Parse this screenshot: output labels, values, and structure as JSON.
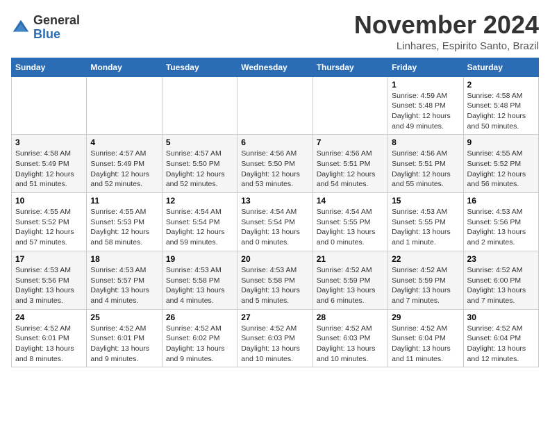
{
  "logo": {
    "general": "General",
    "blue": "Blue"
  },
  "header": {
    "month": "November 2024",
    "location": "Linhares, Espirito Santo, Brazil"
  },
  "weekdays": [
    "Sunday",
    "Monday",
    "Tuesday",
    "Wednesday",
    "Thursday",
    "Friday",
    "Saturday"
  ],
  "weeks": [
    [
      {
        "day": "",
        "info": ""
      },
      {
        "day": "",
        "info": ""
      },
      {
        "day": "",
        "info": ""
      },
      {
        "day": "",
        "info": ""
      },
      {
        "day": "",
        "info": ""
      },
      {
        "day": "1",
        "info": "Sunrise: 4:59 AM\nSunset: 5:48 PM\nDaylight: 12 hours and 49 minutes."
      },
      {
        "day": "2",
        "info": "Sunrise: 4:58 AM\nSunset: 5:48 PM\nDaylight: 12 hours and 50 minutes."
      }
    ],
    [
      {
        "day": "3",
        "info": "Sunrise: 4:58 AM\nSunset: 5:49 PM\nDaylight: 12 hours and 51 minutes."
      },
      {
        "day": "4",
        "info": "Sunrise: 4:57 AM\nSunset: 5:49 PM\nDaylight: 12 hours and 52 minutes."
      },
      {
        "day": "5",
        "info": "Sunrise: 4:57 AM\nSunset: 5:50 PM\nDaylight: 12 hours and 52 minutes."
      },
      {
        "day": "6",
        "info": "Sunrise: 4:56 AM\nSunset: 5:50 PM\nDaylight: 12 hours and 53 minutes."
      },
      {
        "day": "7",
        "info": "Sunrise: 4:56 AM\nSunset: 5:51 PM\nDaylight: 12 hours and 54 minutes."
      },
      {
        "day": "8",
        "info": "Sunrise: 4:56 AM\nSunset: 5:51 PM\nDaylight: 12 hours and 55 minutes."
      },
      {
        "day": "9",
        "info": "Sunrise: 4:55 AM\nSunset: 5:52 PM\nDaylight: 12 hours and 56 minutes."
      }
    ],
    [
      {
        "day": "10",
        "info": "Sunrise: 4:55 AM\nSunset: 5:52 PM\nDaylight: 12 hours and 57 minutes."
      },
      {
        "day": "11",
        "info": "Sunrise: 4:55 AM\nSunset: 5:53 PM\nDaylight: 12 hours and 58 minutes."
      },
      {
        "day": "12",
        "info": "Sunrise: 4:54 AM\nSunset: 5:54 PM\nDaylight: 12 hours and 59 minutes."
      },
      {
        "day": "13",
        "info": "Sunrise: 4:54 AM\nSunset: 5:54 PM\nDaylight: 13 hours and 0 minutes."
      },
      {
        "day": "14",
        "info": "Sunrise: 4:54 AM\nSunset: 5:55 PM\nDaylight: 13 hours and 0 minutes."
      },
      {
        "day": "15",
        "info": "Sunrise: 4:53 AM\nSunset: 5:55 PM\nDaylight: 13 hours and 1 minute."
      },
      {
        "day": "16",
        "info": "Sunrise: 4:53 AM\nSunset: 5:56 PM\nDaylight: 13 hours and 2 minutes."
      }
    ],
    [
      {
        "day": "17",
        "info": "Sunrise: 4:53 AM\nSunset: 5:56 PM\nDaylight: 13 hours and 3 minutes."
      },
      {
        "day": "18",
        "info": "Sunrise: 4:53 AM\nSunset: 5:57 PM\nDaylight: 13 hours and 4 minutes."
      },
      {
        "day": "19",
        "info": "Sunrise: 4:53 AM\nSunset: 5:58 PM\nDaylight: 13 hours and 4 minutes."
      },
      {
        "day": "20",
        "info": "Sunrise: 4:53 AM\nSunset: 5:58 PM\nDaylight: 13 hours and 5 minutes."
      },
      {
        "day": "21",
        "info": "Sunrise: 4:52 AM\nSunset: 5:59 PM\nDaylight: 13 hours and 6 minutes."
      },
      {
        "day": "22",
        "info": "Sunrise: 4:52 AM\nSunset: 5:59 PM\nDaylight: 13 hours and 7 minutes."
      },
      {
        "day": "23",
        "info": "Sunrise: 4:52 AM\nSunset: 6:00 PM\nDaylight: 13 hours and 7 minutes."
      }
    ],
    [
      {
        "day": "24",
        "info": "Sunrise: 4:52 AM\nSunset: 6:01 PM\nDaylight: 13 hours and 8 minutes."
      },
      {
        "day": "25",
        "info": "Sunrise: 4:52 AM\nSunset: 6:01 PM\nDaylight: 13 hours and 9 minutes."
      },
      {
        "day": "26",
        "info": "Sunrise: 4:52 AM\nSunset: 6:02 PM\nDaylight: 13 hours and 9 minutes."
      },
      {
        "day": "27",
        "info": "Sunrise: 4:52 AM\nSunset: 6:03 PM\nDaylight: 13 hours and 10 minutes."
      },
      {
        "day": "28",
        "info": "Sunrise: 4:52 AM\nSunset: 6:03 PM\nDaylight: 13 hours and 10 minutes."
      },
      {
        "day": "29",
        "info": "Sunrise: 4:52 AM\nSunset: 6:04 PM\nDaylight: 13 hours and 11 minutes."
      },
      {
        "day": "30",
        "info": "Sunrise: 4:52 AM\nSunset: 6:04 PM\nDaylight: 13 hours and 12 minutes."
      }
    ]
  ]
}
